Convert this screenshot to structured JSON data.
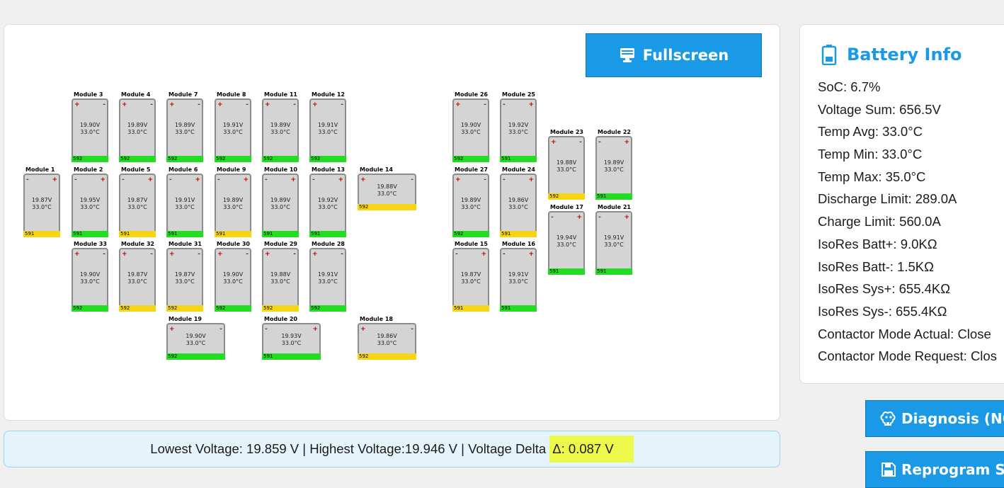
{
  "main": {
    "fullscreen_label": "Fullscreen",
    "fullscreen_icon": "monitor-icon"
  },
  "modules": [
    {
      "name": "Module 3",
      "voltage": "19.90V",
      "temp": "33.0°C",
      "id": "592",
      "status": "green",
      "left_pol": "+",
      "right_pol": "-"
    },
    {
      "name": "Module 4",
      "voltage": "19.89V",
      "temp": "33.0°C",
      "id": "592",
      "status": "green",
      "left_pol": "+",
      "right_pol": "-"
    },
    {
      "name": "Module 7",
      "voltage": "19.89V",
      "temp": "33.0°C",
      "id": "592",
      "status": "green",
      "left_pol": "+",
      "right_pol": "-"
    },
    {
      "name": "Module 8",
      "voltage": "19.91V",
      "temp": "33.0°C",
      "id": "592",
      "status": "green",
      "left_pol": "+",
      "right_pol": "-"
    },
    {
      "name": "Module 11",
      "voltage": "19.89V",
      "temp": "33.0°C",
      "id": "592",
      "status": "green",
      "left_pol": "+",
      "right_pol": "-"
    },
    {
      "name": "Module 12",
      "voltage": "19.91V",
      "temp": "33.0°C",
      "id": "592",
      "status": "green",
      "left_pol": "+",
      "right_pol": "-"
    },
    {
      "name": "Module 26",
      "voltage": "19.90V",
      "temp": "33.0°C",
      "id": "592",
      "status": "green",
      "left_pol": "+",
      "right_pol": "-"
    },
    {
      "name": "Module 25",
      "voltage": "19.92V",
      "temp": "33.0°C",
      "id": "591",
      "status": "green",
      "left_pol": "-",
      "right_pol": "+"
    },
    {
      "name": "Module 23",
      "voltage": "19.88V",
      "temp": "33.0°C",
      "id": "592",
      "status": "yellow",
      "left_pol": "+",
      "right_pol": "-"
    },
    {
      "name": "Module 22",
      "voltage": "19.89V",
      "temp": "33.0°C",
      "id": "591",
      "status": "green",
      "left_pol": "-",
      "right_pol": "+"
    },
    {
      "name": "Module 1",
      "voltage": "19.87V",
      "temp": "33.0°C",
      "id": "591",
      "status": "yellow",
      "left_pol": "-",
      "right_pol": "+"
    },
    {
      "name": "Module 2",
      "voltage": "19.95V",
      "temp": "33.0°C",
      "id": "591",
      "status": "green",
      "left_pol": "-",
      "right_pol": "+"
    },
    {
      "name": "Module 5",
      "voltage": "19.87V",
      "temp": "33.0°C",
      "id": "591",
      "status": "yellow",
      "left_pol": "-",
      "right_pol": "+"
    },
    {
      "name": "Module 6",
      "voltage": "19.91V",
      "temp": "33.0°C",
      "id": "591",
      "status": "green",
      "left_pol": "-",
      "right_pol": "+"
    },
    {
      "name": "Module 9",
      "voltage": "19.89V",
      "temp": "33.0°C",
      "id": "591",
      "status": "yellow",
      "left_pol": "-",
      "right_pol": "+"
    },
    {
      "name": "Module 10",
      "voltage": "19.89V",
      "temp": "33.0°C",
      "id": "591",
      "status": "green",
      "left_pol": "-",
      "right_pol": "+"
    },
    {
      "name": "Module 13",
      "voltage": "19.92V",
      "temp": "33.0°C",
      "id": "591",
      "status": "green",
      "left_pol": "-",
      "right_pol": "+"
    },
    {
      "name": "Module 14",
      "voltage": "19.88V",
      "temp": "33.0°C",
      "id": "592",
      "status": "yellow",
      "left_pol": "+",
      "right_pol": "-"
    },
    {
      "name": "Module 27",
      "voltage": "19.89V",
      "temp": "33.0°C",
      "id": "592",
      "status": "green",
      "left_pol": "+",
      "right_pol": "-"
    },
    {
      "name": "Module 24",
      "voltage": "19.86V",
      "temp": "33.0°C",
      "id": "591",
      "status": "yellow",
      "left_pol": "-",
      "right_pol": "+"
    },
    {
      "name": "Module 17",
      "voltage": "19.94V",
      "temp": "33.0°C",
      "id": "591",
      "status": "green",
      "left_pol": "-",
      "right_pol": "+"
    },
    {
      "name": "Module 21",
      "voltage": "19.91V",
      "temp": "33.0°C",
      "id": "591",
      "status": "green",
      "left_pol": "-",
      "right_pol": "+"
    },
    {
      "name": "Module 33",
      "voltage": "19.90V",
      "temp": "33.0°C",
      "id": "592",
      "status": "green",
      "left_pol": "+",
      "right_pol": "-"
    },
    {
      "name": "Module 32",
      "voltage": "19.87V",
      "temp": "33.0°C",
      "id": "592",
      "status": "yellow",
      "left_pol": "+",
      "right_pol": "-"
    },
    {
      "name": "Module 31",
      "voltage": "19.87V",
      "temp": "33.0°C",
      "id": "592",
      "status": "yellow",
      "left_pol": "+",
      "right_pol": "-"
    },
    {
      "name": "Module 30",
      "voltage": "19.90V",
      "temp": "33.0°C",
      "id": "592",
      "status": "green",
      "left_pol": "+",
      "right_pol": "-"
    },
    {
      "name": "Module 29",
      "voltage": "19.88V",
      "temp": "33.0°C",
      "id": "592",
      "status": "yellow",
      "left_pol": "+",
      "right_pol": "-"
    },
    {
      "name": "Module 28",
      "voltage": "19.91V",
      "temp": "33.0°C",
      "id": "592",
      "status": "green",
      "left_pol": "+",
      "right_pol": "-"
    },
    {
      "name": "Module 15",
      "voltage": "19.87V",
      "temp": "33.0°C",
      "id": "591",
      "status": "yellow",
      "left_pol": "-",
      "right_pol": "+"
    },
    {
      "name": "Module 16",
      "voltage": "19.91V",
      "temp": "33.0°C",
      "id": "591",
      "status": "green",
      "left_pol": "-",
      "right_pol": "+"
    },
    {
      "name": "Module 19",
      "voltage": "19.90V",
      "temp": "33.0°C",
      "id": "592",
      "status": "green",
      "left_pol": "+",
      "right_pol": "-"
    },
    {
      "name": "Module 20",
      "voltage": "19.93V",
      "temp": "33.0°C",
      "id": "591",
      "status": "green",
      "left_pol": "-",
      "right_pol": "+"
    },
    {
      "name": "Module 18",
      "voltage": "19.86V",
      "temp": "33.0°C",
      "id": "592",
      "status": "yellow",
      "left_pol": "+",
      "right_pol": "-"
    }
  ],
  "battery_info": {
    "title": "Battery Info",
    "icon": "battery-icon",
    "items": [
      "SoC: 6.7%",
      "Voltage Sum: 656.5V",
      "Temp Avg: 33.0°C",
      "Temp Min: 33.0°C",
      "Temp Max: 35.0°C",
      "Discharge Limit: 289.0A",
      "Charge Limit: 560.0A",
      "IsoRes Batt+: 9.0KΩ",
      "IsoRes Batt-: 1.5KΩ",
      "IsoRes Sys+: 655.4KΩ",
      "IsoRes Sys-: 655.4KΩ",
      "Contactor Mode Actual: Close",
      "Contactor Mode Request: Clos"
    ]
  },
  "side_buttons": {
    "diagnosis_label": "Diagnosis (NC",
    "reprogram_label": "Reprogram SV"
  },
  "footer": {
    "summary_text": "Lowest Voltage: 19.859 V | Highest Voltage:19.946 V | Voltage Delta ",
    "delta_text": "Δ: 0.087 V"
  },
  "colors": {
    "accent": "#1a9ae6",
    "status_green": "#22dd22",
    "status_yellow": "#f5d514",
    "highlight": "#edf94a"
  }
}
